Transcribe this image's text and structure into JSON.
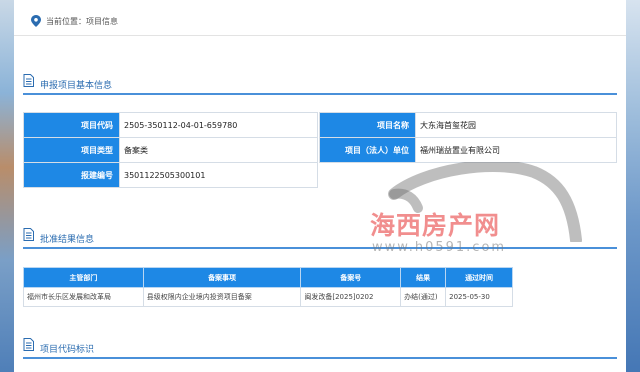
{
  "breadcrumb": {
    "text": "当前位置：项目信息"
  },
  "sections": {
    "basic": "申报项目基本信息",
    "result": "批准结果信息",
    "code": "项目代码标识"
  },
  "basic_info": {
    "project_code_label": "项目代码",
    "project_code": "2505-350112-04-01-659780",
    "project_name_label": "项目名称",
    "project_name": "大东海首玺花园",
    "project_type_label": "项目类型",
    "project_type": "备案类",
    "unit_label": "项目（法人）单位",
    "unit": "福州瑞益置业有限公司",
    "report_no_label": "报建编号",
    "report_no": "3501122505300101"
  },
  "result_table": {
    "headers": [
      "主管部门",
      "备案事项",
      "备案号",
      "结果",
      "通过时间"
    ],
    "rows": [
      [
        "福州市长乐区发展和改革局",
        "县级权限内企业境内投资项目备案",
        "闽发改备[2025]0202",
        "办结(通过)",
        "2025-05-30"
      ]
    ]
  },
  "watermark": {
    "cn": "海西房产网",
    "url": "www.h0591.com"
  },
  "colors": {
    "accent": "#1e88e5",
    "title": "#2b6cb0",
    "rule": "#4a90d9"
  }
}
